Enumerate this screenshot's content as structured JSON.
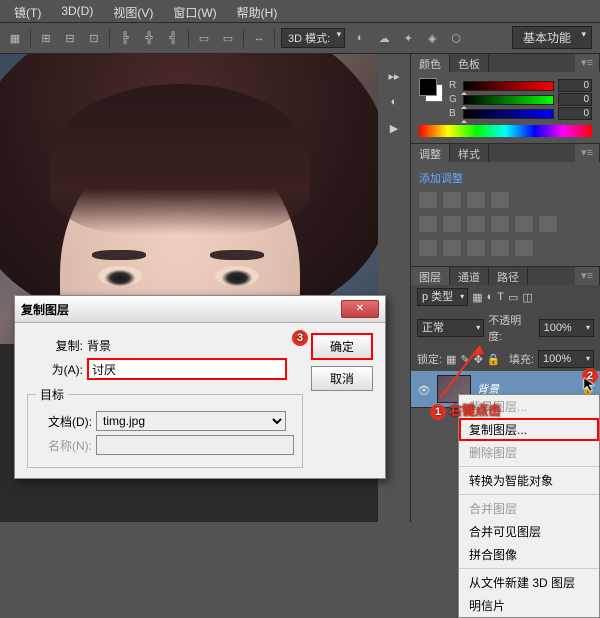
{
  "menu": {
    "items": [
      "镜(T)",
      "3D(D)",
      "视图(V)",
      "窗口(W)",
      "帮助(H)"
    ]
  },
  "workspace": {
    "preset": "基本功能"
  },
  "optionbar": {
    "mode_label": "3D 模式:"
  },
  "panels": {
    "color": {
      "tab": "颜色",
      "tab2": "色板",
      "r": {
        "label": "R",
        "value": "0"
      },
      "g": {
        "label": "G",
        "value": "0"
      },
      "b": {
        "label": "B",
        "value": "0"
      }
    },
    "adjust": {
      "tab": "调整",
      "tab2": "样式",
      "link": "添加调整"
    },
    "layers": {
      "tab": "图层",
      "tab2": "通道",
      "tab3": "路径",
      "kind": "p 类型",
      "blend": "正常",
      "opacity_label": "不透明度:",
      "opacity": "100%",
      "lock_label": "锁定:",
      "fill_label": "填充:",
      "fill": "100%",
      "layer_bg": "背景"
    }
  },
  "context": {
    "items": [
      "背景图层...",
      "复制图层...",
      "删除图层",
      "转换为智能对象",
      "合并图层",
      "合并可见图层",
      "拼合图像",
      "从文件新建 3D 图层",
      "明信片"
    ]
  },
  "dialog": {
    "title": "复制图层",
    "copy_label": "复制:",
    "copy_value": "背景",
    "as_label": "为(A):",
    "as_value": "讨厌",
    "target_legend": "目标",
    "doc_label": "文档(D):",
    "doc_value": "timg.jpg",
    "name_label": "名称(N):",
    "ok": "确定",
    "cancel": "取消"
  },
  "annotations": {
    "n1": "1",
    "t1": "右键点击",
    "n2": "2",
    "n3": "3"
  }
}
